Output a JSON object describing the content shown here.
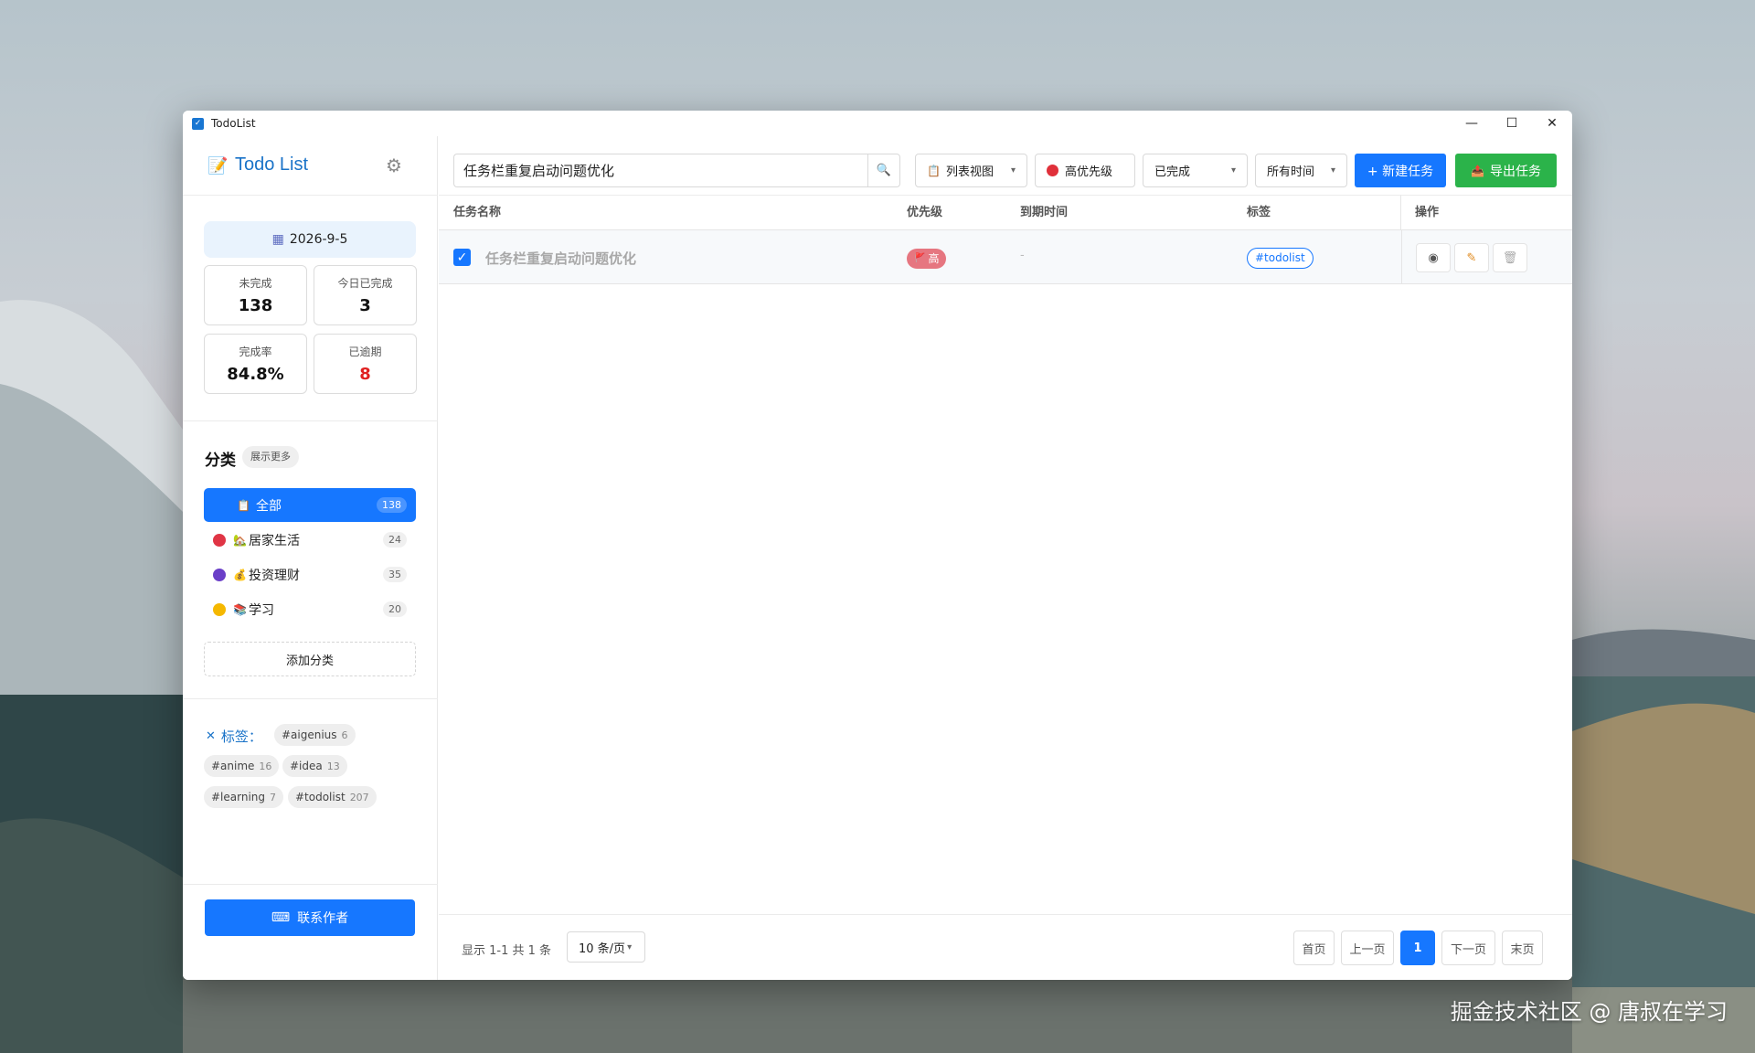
{
  "window": {
    "title": "TodoList",
    "minimize_glyph": "—",
    "maximize_glyph": "☐",
    "close_glyph": "✕"
  },
  "sidebar": {
    "app_title": "Todo List",
    "date": "2026-9-5",
    "stats": [
      {
        "label": "未完成",
        "value": "138"
      },
      {
        "label": "今日已完成",
        "value": "3"
      },
      {
        "label": "完成率",
        "value": "84.8%"
      },
      {
        "label": "已逾期",
        "value": "8"
      }
    ],
    "categories_title": "分类",
    "show_more": "展示更多",
    "categories": [
      {
        "label": "全部",
        "count": "138",
        "icon": "📋"
      },
      {
        "label": "居家生活",
        "count": "24",
        "icon": "🏡",
        "dot_color": "#e03545"
      },
      {
        "label": "投资理财",
        "count": "35",
        "icon": "💰",
        "dot_color": "#6a3fc8"
      },
      {
        "label": "学习",
        "count": "20",
        "icon": "📚",
        "dot_color": "#f5b800"
      }
    ],
    "add_category": "添加分类",
    "tags_title": "标签：",
    "tags": [
      {
        "name": "#aigenius",
        "count": "6"
      },
      {
        "name": "#anime",
        "count": "16"
      },
      {
        "name": "#idea",
        "count": "13"
      },
      {
        "name": "#learning",
        "count": "7"
      },
      {
        "name": "#todolist",
        "count": "207"
      }
    ],
    "contact_button": "联系作者"
  },
  "toolbar": {
    "search_value": "任务栏重复启动问题优化",
    "view_select": "列表视图",
    "priority_select": "高优先级",
    "status_select": "已完成",
    "time_select": "所有时间",
    "new_task_button": "+ 新建任务",
    "export_button": "导出任务"
  },
  "table": {
    "headers": [
      "任务名称",
      "优先级",
      "到期时间",
      "标签",
      "操作"
    ],
    "rows": [
      {
        "checked": true,
        "name": "任务栏重复启动问题优化",
        "priority": "高",
        "due": "-",
        "tag": "#todolist"
      }
    ]
  },
  "pagination": {
    "info": "显示 1-1 共 1 条",
    "page_size": "10 条/页",
    "first": "首页",
    "prev": "上一页",
    "current": "1",
    "next": "下一页",
    "last": "末页"
  },
  "watermark": "掘金技术社区 @ 唐叔在学习",
  "colors": {
    "primary": "#1677ff",
    "export_green": "#2bb34a",
    "overdue_red": "#e02020",
    "priority_badge": "#e67680"
  }
}
